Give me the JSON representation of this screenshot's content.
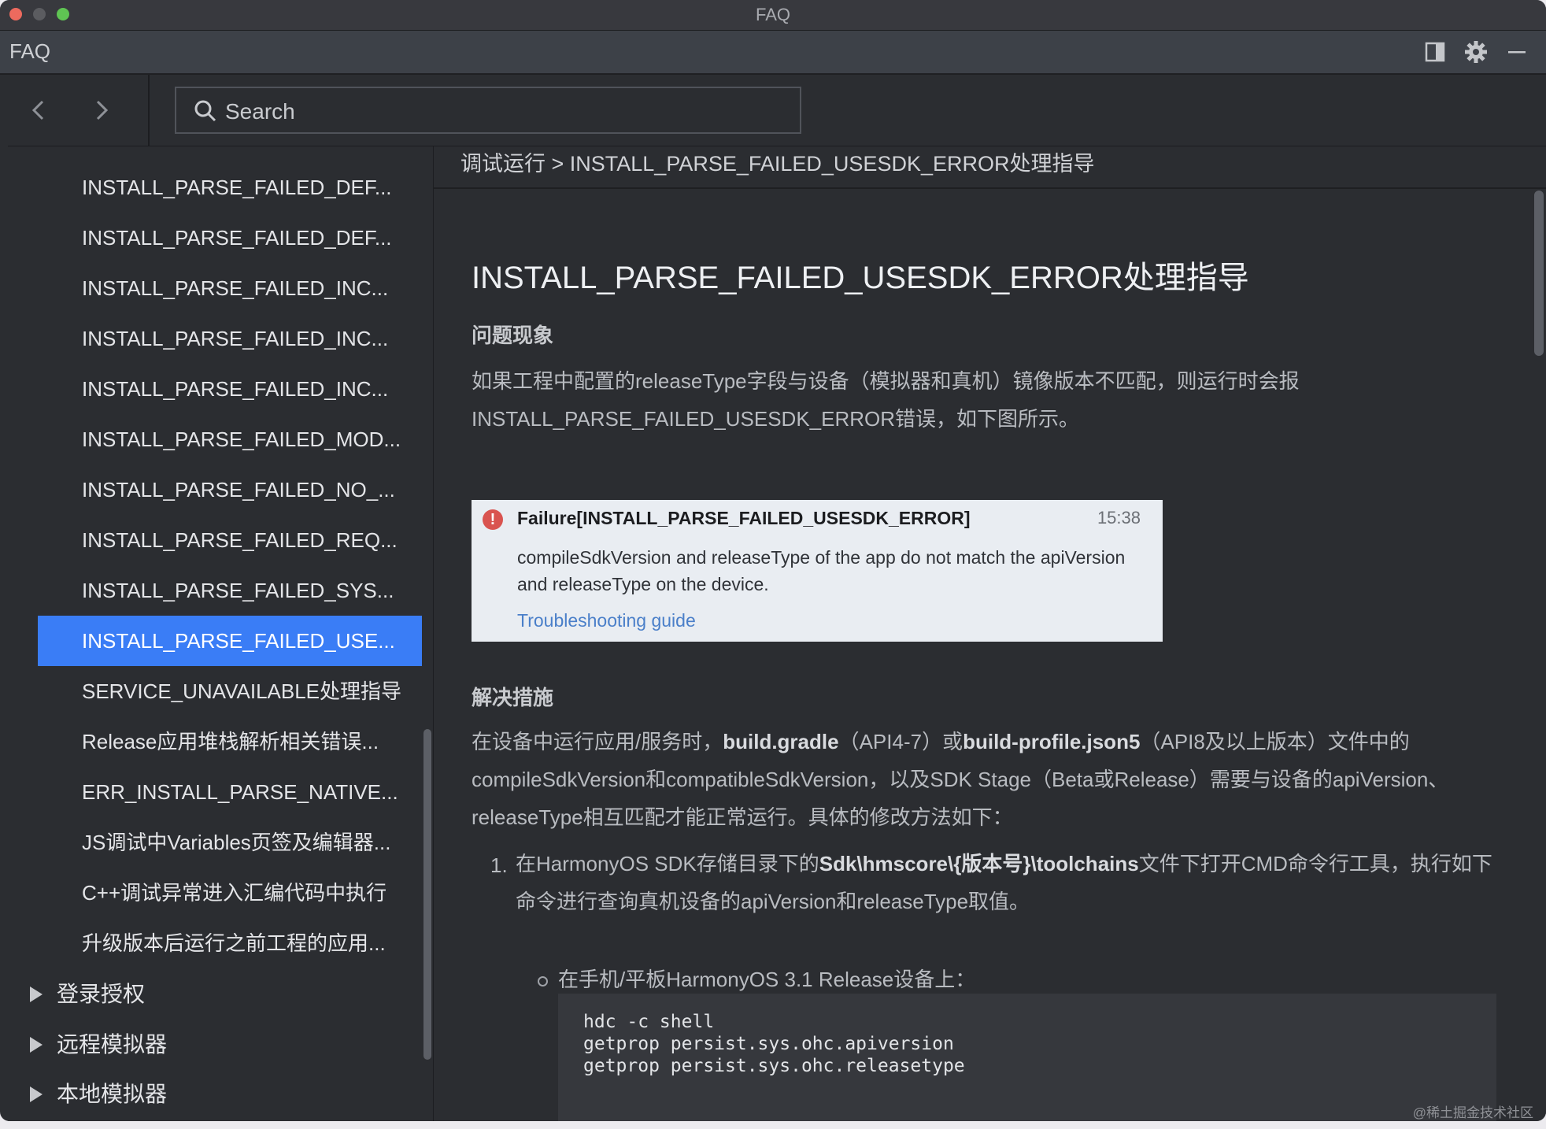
{
  "window": {
    "title": "FAQ"
  },
  "header": {
    "title": "FAQ"
  },
  "search": {
    "placeholder": "Search"
  },
  "sidebar": {
    "items": [
      "INSTALL_PARSE_FAILED_DEF...",
      "INSTALL_PARSE_FAILED_DEF...",
      "INSTALL_PARSE_FAILED_INC...",
      "INSTALL_PARSE_FAILED_INC...",
      "INSTALL_PARSE_FAILED_INC...",
      "INSTALL_PARSE_FAILED_MOD...",
      "INSTALL_PARSE_FAILED_NO_...",
      "INSTALL_PARSE_FAILED_REQ...",
      "INSTALL_PARSE_FAILED_SYS...",
      "INSTALL_PARSE_FAILED_USE...",
      "SERVICE_UNAVAILABLE处理指导",
      "Release应用堆栈解析相关错误...",
      "ERR_INSTALL_PARSE_NATIVE...",
      "JS调试中Variables页签及编辑器...",
      "C++调试异常进入汇编代码中执行",
      "升级版本后运行之前工程的应用..."
    ],
    "groups": [
      "登录授权",
      "远程模拟器",
      "本地模拟器"
    ]
  },
  "content": {
    "breadcrumb": "调试运行 > INSTALL_PARSE_FAILED_USESDK_ERROR处理指导",
    "title": "INSTALL_PARSE_FAILED_USESDK_ERROR处理指导",
    "section1": "问题现象",
    "para1": "如果工程中配置的releaseType字段与设备（模拟器和真机）镜像版本不匹配，则运行时会报INSTALL_PARSE_FAILED_USESDK_ERROR错误，如下图所示。",
    "screenshot": {
      "title": "Failure[INSTALL_PARSE_FAILED_USESDK_ERROR]",
      "time": "15:38",
      "body": "compileSdkVersion and releaseType of the app do not match the apiVersion and releaseType on the device.",
      "link": "Troubleshooting guide"
    },
    "section2": "解决措施",
    "para2": {
      "p1": "在设备中运行应用/服务时，",
      "b1": "build.gradle",
      "p2": "（API4-7）或",
      "b2": "build-profile.json5",
      "p3": "（API8及以上版本）文件中的compileSdkVersion和compatibleSdkVersion，以及SDK Stage（Beta或Release）需要与设备的apiVersion、releaseType相互匹配才能正常运行。具体的修改方法如下："
    },
    "step1": {
      "num": "1.",
      "p1": "在HarmonyOS SDK存储目录下的",
      "b1": "Sdk\\hmscore\\{版本号}\\toolchains",
      "p2": "文件下打开CMD命令行工具，执行如下命令进行查询真机设备的apiVersion和releaseType取值。"
    },
    "substep": "在手机/平板HarmonyOS 3.1 Release设备上：",
    "code": "hdc -c shell\ngetprop persist.sys.ohc.apiversion\ngetprop persist.sys.ohc.releasetype"
  },
  "watermark": "@稀土掘金技术社区"
}
